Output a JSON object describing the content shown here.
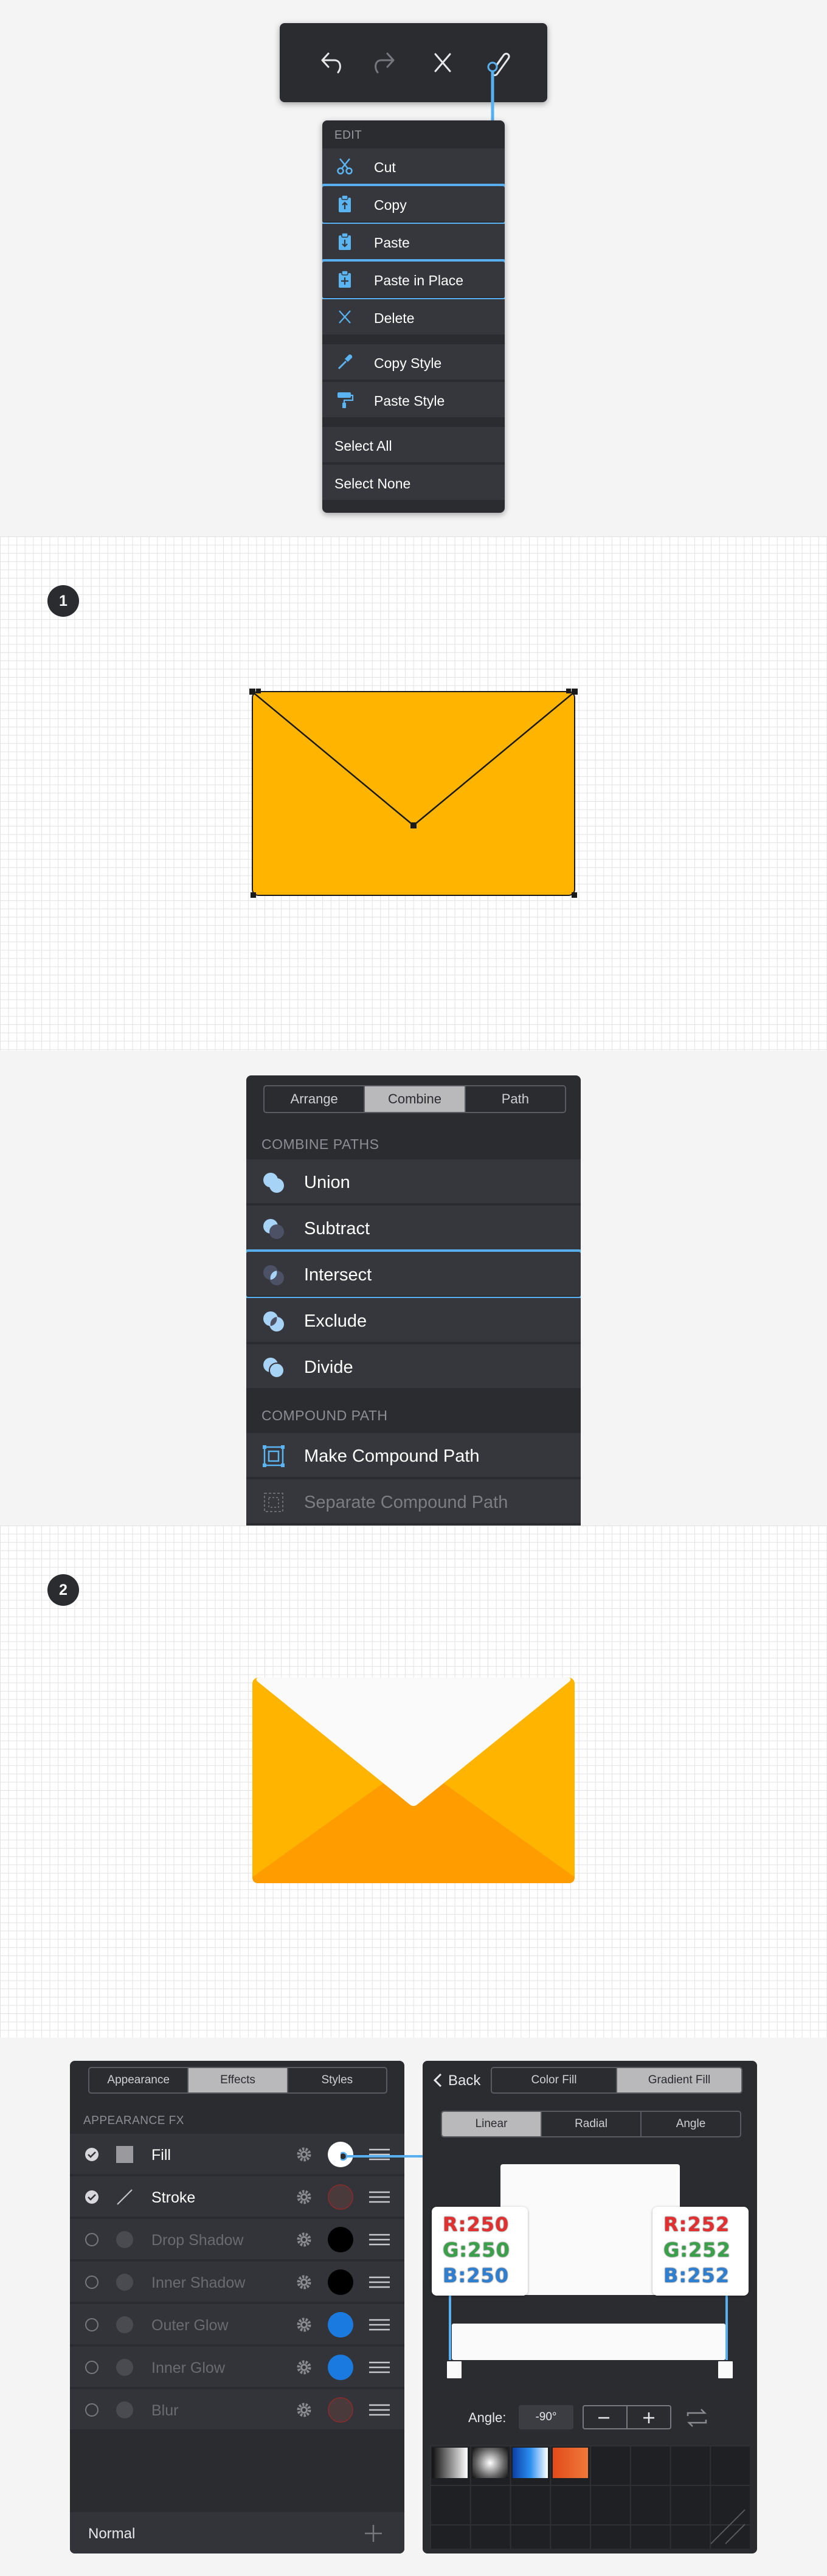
{
  "edit_menu": {
    "header": "EDIT",
    "items": [
      {
        "label": "Cut",
        "icon": "scissors-icon"
      },
      {
        "label": "Copy",
        "icon": "clipboard-copy-icon",
        "highlighted": true
      },
      {
        "label": "Paste",
        "icon": "clipboard-paste-icon"
      },
      {
        "label": "Paste in Place",
        "icon": "clipboard-paste-in-place-icon",
        "highlighted": true
      },
      {
        "label": "Delete",
        "icon": "close-icon"
      },
      {
        "label": "Copy Style",
        "icon": "eyedropper-icon"
      },
      {
        "label": "Paste Style",
        "icon": "paint-roller-icon"
      },
      {
        "label": "Select All"
      },
      {
        "label": "Select None"
      }
    ]
  },
  "toolbar": {
    "icons": [
      "undo-icon",
      "redo-icon",
      "close-icon",
      "paperclip-icon"
    ]
  },
  "steps": {
    "step1": "1",
    "step2": "2"
  },
  "combine_panel": {
    "tabs": [
      "Arrange",
      "Combine",
      "Path"
    ],
    "active_tab": "Combine",
    "section_combine": "COMBINE PATHS",
    "items": [
      "Union",
      "Subtract",
      "Intersect",
      "Exclude",
      "Divide"
    ],
    "highlighted": "Intersect",
    "section_compound": "COMPOUND PATH",
    "compound_items": [
      "Make Compound Path",
      "Separate Compound Path"
    ]
  },
  "effects_panel": {
    "tabs": [
      "Appearance",
      "Effects",
      "Styles"
    ],
    "active_tab": "Effects",
    "section": "APPEARANCE FX",
    "rows": [
      {
        "label": "Fill",
        "enabled": true
      },
      {
        "label": "Stroke",
        "enabled": true
      },
      {
        "label": "Drop Shadow",
        "enabled": false
      },
      {
        "label": "Inner Shadow",
        "enabled": false
      },
      {
        "label": "Outer Glow",
        "enabled": false
      },
      {
        "label": "Inner Glow",
        "enabled": false
      },
      {
        "label": "Blur",
        "enabled": false
      }
    ],
    "blend_mode": "Normal"
  },
  "gradient_panel": {
    "back_label": "Back",
    "fill_tabs": [
      "Color Fill",
      "Gradient Fill"
    ],
    "active_fill_tab": "Gradient Fill",
    "type_tabs": [
      "Linear",
      "Radial",
      "Angle"
    ],
    "active_type_tab": "Linear",
    "angle_label": "Angle:",
    "angle_value": "-90°",
    "stop_left": {
      "r": "R:250",
      "g": "G:250",
      "b": "B:250"
    },
    "stop_right": {
      "r": "R:252",
      "g": "G:252",
      "b": "B:252"
    }
  },
  "colors": {
    "envelope_body": "#ffb400",
    "envelope_flap_dark": "#ff9c00",
    "envelope_letter": "#fafafa",
    "highlight": "#58b0f0",
    "panel": "#2b2c30",
    "icon_blue": "#5ab4f2"
  }
}
